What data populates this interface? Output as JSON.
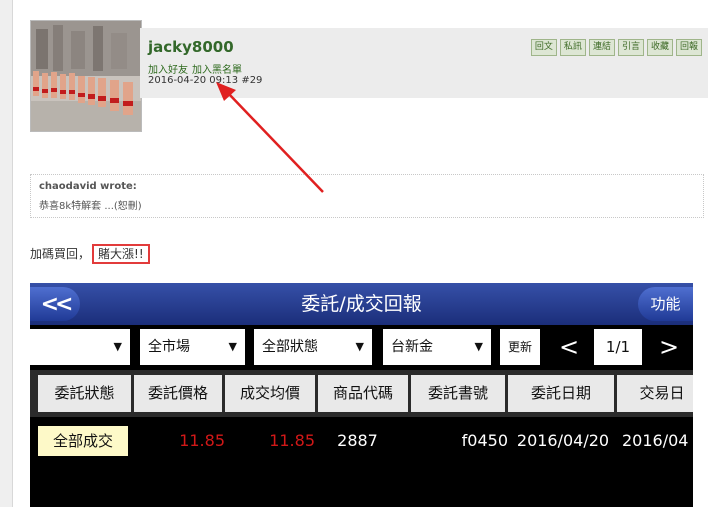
{
  "post": {
    "username": "jacky8000",
    "add_friend": "加入好友",
    "add_blacklist": "加入黑名單",
    "datetime": "2016-04-20 09:13",
    "post_number": "#29",
    "actions": [
      "回文",
      "私訊",
      "連結",
      "引言",
      "收藏",
      "回報"
    ]
  },
  "quote": {
    "title": "chaodavid wrote:",
    "body": "恭喜8k特解套 ...(恕刪)"
  },
  "reply": {
    "prefix": "加碼買回，",
    "highlight": "賭大漲!!"
  },
  "app": {
    "title": "委託/成交回報",
    "back_label": "<<",
    "func_label": "功能",
    "toolbar": {
      "dd1": "",
      "dd2": "全市場",
      "dd3": "全部狀態",
      "dd4": "台新金",
      "refresh": "更新",
      "prev": "<",
      "page": "1/1",
      "next": ">"
    },
    "columns": [
      "委託狀態",
      "委託價格",
      "成交均價",
      "商品代碼",
      "委託書號",
      "委託日期",
      "交易日"
    ],
    "rows": [
      {
        "status": "全部成交",
        "price": "11.85",
        "avg": "11.85",
        "code": "2887",
        "order_no": "f0450",
        "date": "2016/04/20",
        "trade": "2016/04"
      }
    ]
  },
  "colors": {
    "username": "#33682a",
    "highlight_box": "#e23b3b",
    "arrow": "#e02020",
    "price_red": "#d21818",
    "app_title_bar": "#1b2e7a"
  }
}
